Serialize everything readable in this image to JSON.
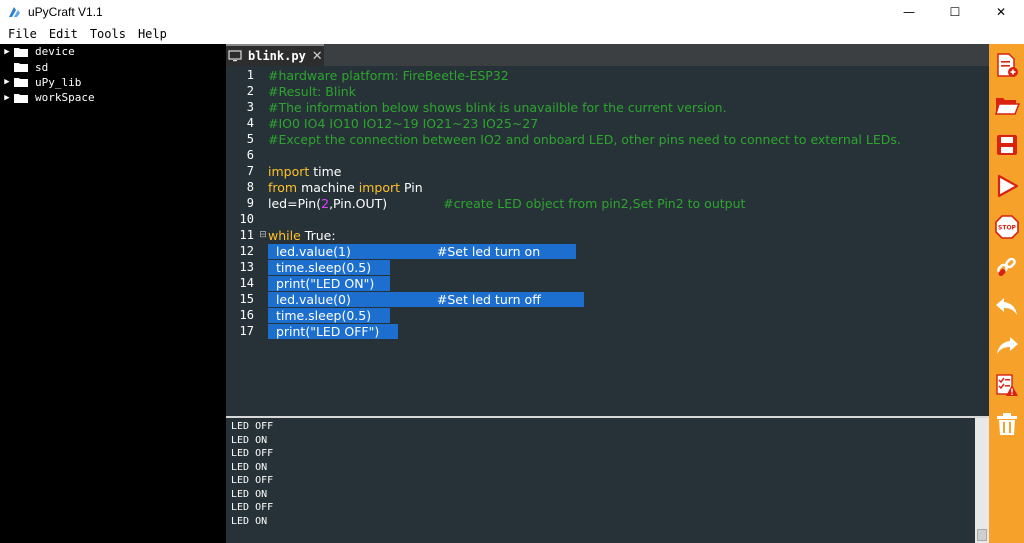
{
  "window": {
    "title": "uPyCraft V1.1",
    "minimize_glyph": "—",
    "maximize_glyph": "☐",
    "close_glyph": "✕"
  },
  "menu": {
    "items": [
      "File",
      "Edit",
      "Tools",
      "Help"
    ]
  },
  "tree": {
    "items": [
      {
        "label": "device",
        "expandable": true
      },
      {
        "label": "sd",
        "expandable": false
      },
      {
        "label": "uPy_lib",
        "expandable": true
      },
      {
        "label": "workSpace",
        "expandable": true
      }
    ]
  },
  "editor": {
    "tab_label": "blink.py",
    "tab_close": "✕",
    "line_numbers": [
      "1",
      "2",
      "3",
      "4",
      "5",
      "6",
      "7",
      "8",
      "9",
      "10",
      "11",
      "12",
      "13",
      "14",
      "15",
      "16",
      "17"
    ],
    "fold_marker": "⊟",
    "lines": {
      "l1": "#hardware platform: FireBeetle-ESP32",
      "l2": "#Result: Blink",
      "l3": "#The information below shows blink is unavailble for the current version.",
      "l4": "#IO0 IO4 IO10 IO12~19 IO21~23 IO25~27",
      "l5": "#Except the connection between IO2 and onboard LED, other pins need to connect to external LEDs.",
      "l7_kw": "import",
      "l7_txt": " time",
      "l8_kw1": "from",
      "l8_txt1": " machine ",
      "l8_kw2": "import",
      "l8_txt2": " Pin",
      "l9_a": "led=Pin(",
      "l9_num": "2",
      "l9_b": ",Pin.OUT)",
      "l9_cmt": "#create LED object from pin2,Set Pin2 to output",
      "l11_kw": "while",
      "l11_txt": " True:",
      "l12_code": "  led.value(1)",
      "l12_cmt": "#Set led turn on",
      "l13": "  time.sleep(0.5)",
      "l14": "  print(\"LED ON\")",
      "l15_code": "  led.value(0)",
      "l15_cmt": "#Set led turn off",
      "l16": "  time.sleep(0.5)",
      "l17": "  print(\"LED OFF\")"
    }
  },
  "terminal": {
    "lines": [
      "LED OFF",
      "LED ON",
      "LED OFF",
      "LED ON",
      "LED OFF",
      "LED ON",
      "LED OFF",
      "LED ON"
    ]
  },
  "colors": {
    "tree_bg": "#000000",
    "editor_bg": "#263238",
    "comment": "#2ea52e",
    "keyword": "#ffc02b",
    "number": "#e040fb",
    "selection": "#1c6fcf",
    "toolbar_bg": "#f5a12a",
    "toolbar_icon": "#d9230f"
  },
  "toolbar": {
    "icons": [
      "new-file-icon",
      "open-folder-icon",
      "save-icon",
      "run-icon",
      "stop-icon",
      "connect-icon",
      "undo-icon",
      "redo-icon",
      "syntax-check-icon",
      "clear-icon"
    ]
  }
}
